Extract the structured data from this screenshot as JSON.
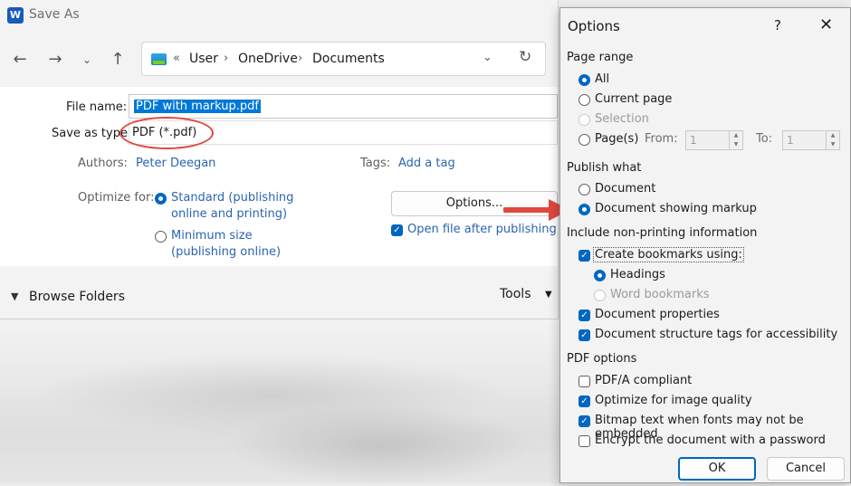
{
  "saveas": {
    "title": "Save As",
    "logo_letter": "W",
    "breadcrumb": [
      "User",
      "OneDrive",
      "Documents"
    ],
    "breadcrumb_prefix": "«",
    "file_name_label": "File name:",
    "file_name_value": "PDF with markup.pdf",
    "save_as_type_label": "Save as type:",
    "save_as_type_value": "PDF (*.pdf)",
    "authors_label": "Authors:",
    "authors_value": "Peter Deegan",
    "tags_label": "Tags:",
    "tags_value": "Add a tag",
    "optimize_label": "Optimize for:",
    "optimize_standard_line1": "Standard (publishing",
    "optimize_standard_line2": "online and printing)",
    "optimize_minimum_line1": "Minimum size",
    "optimize_minimum_line2": "(publishing online)",
    "options_button": "Options...",
    "open_after_label": "Open file after publishing",
    "browse_folders": "Browse Folders",
    "tools": "Tools"
  },
  "options": {
    "title": "Options",
    "help": "?",
    "page_range_heading": "Page range",
    "all": "All",
    "current_page": "Current page",
    "selection": "Selection",
    "pages": "Page(s)",
    "from_label": "From:",
    "from_value": "1",
    "to_label": "To:",
    "to_value": "1",
    "publish_what_heading": "Publish what",
    "document": "Document",
    "document_markup": "Document showing markup",
    "nonprinting_heading": "Include non-printing information",
    "create_bookmarks": "Create bookmarks using:",
    "headings": "Headings",
    "word_bookmarks": "Word bookmarks",
    "doc_properties": "Document properties",
    "doc_structure_tags": "Document structure tags for accessibility",
    "pdf_options_heading": "PDF options",
    "pdfa": "PDF/A compliant",
    "optimize_quality": "Optimize for image quality",
    "bitmap_text": "Bitmap text when fonts may not be embedded",
    "encrypt": "Encrypt the document with a password",
    "ok": "OK",
    "cancel": "Cancel"
  },
  "colors": {
    "accent": "#0067c0",
    "annotation_red": "#e0483e",
    "link": "#2a64b2"
  }
}
